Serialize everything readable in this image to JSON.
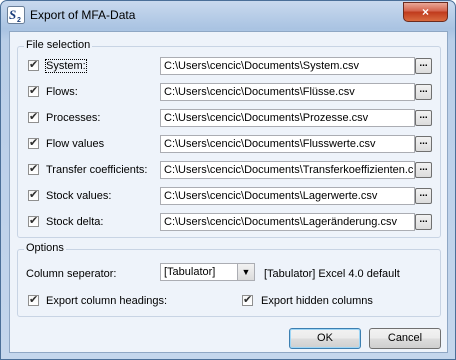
{
  "window": {
    "title": "Export of MFA-Data",
    "close_label": "×"
  },
  "file_selection": {
    "title": "File selection",
    "browse_label": "...",
    "rows": [
      {
        "label": "System:",
        "path": "C:\\Users\\cencic\\Documents\\System.csv",
        "checked": true
      },
      {
        "label": "Flows:",
        "path": "C:\\Users\\cencic\\Documents\\Flüsse.csv",
        "checked": true
      },
      {
        "label": "Processes:",
        "path": "C:\\Users\\cencic\\Documents\\Prozesse.csv",
        "checked": true
      },
      {
        "label": "Flow values",
        "path": "C:\\Users\\cencic\\Documents\\Flusswerte.csv",
        "checked": true
      },
      {
        "label": "Transfer coefficients:",
        "path": "C:\\Users\\cencic\\Documents\\Transferkoeffizienten.c",
        "checked": true
      },
      {
        "label": "Stock values:",
        "path": "C:\\Users\\cencic\\Documents\\Lagerwerte.csv",
        "checked": true
      },
      {
        "label": "Stock delta:",
        "path": "C:\\Users\\cencic\\Documents\\Lageränderung.csv",
        "checked": true
      }
    ]
  },
  "options": {
    "title": "Options",
    "separator_label": "Column seperator:",
    "separator_value": "[Tabulator]",
    "separator_hint": "[Tabulator] Excel 4.0 default",
    "export_headings_label": "Export column headings:",
    "export_headings_checked": true,
    "export_hidden_label": "Export hidden columns",
    "export_hidden_checked": true
  },
  "buttons": {
    "ok": "OK",
    "cancel": "Cancel"
  },
  "colors": {
    "title_bar": "#b9cee8",
    "close_button": "#c03a1d",
    "client_bg": "#eef3fa"
  }
}
